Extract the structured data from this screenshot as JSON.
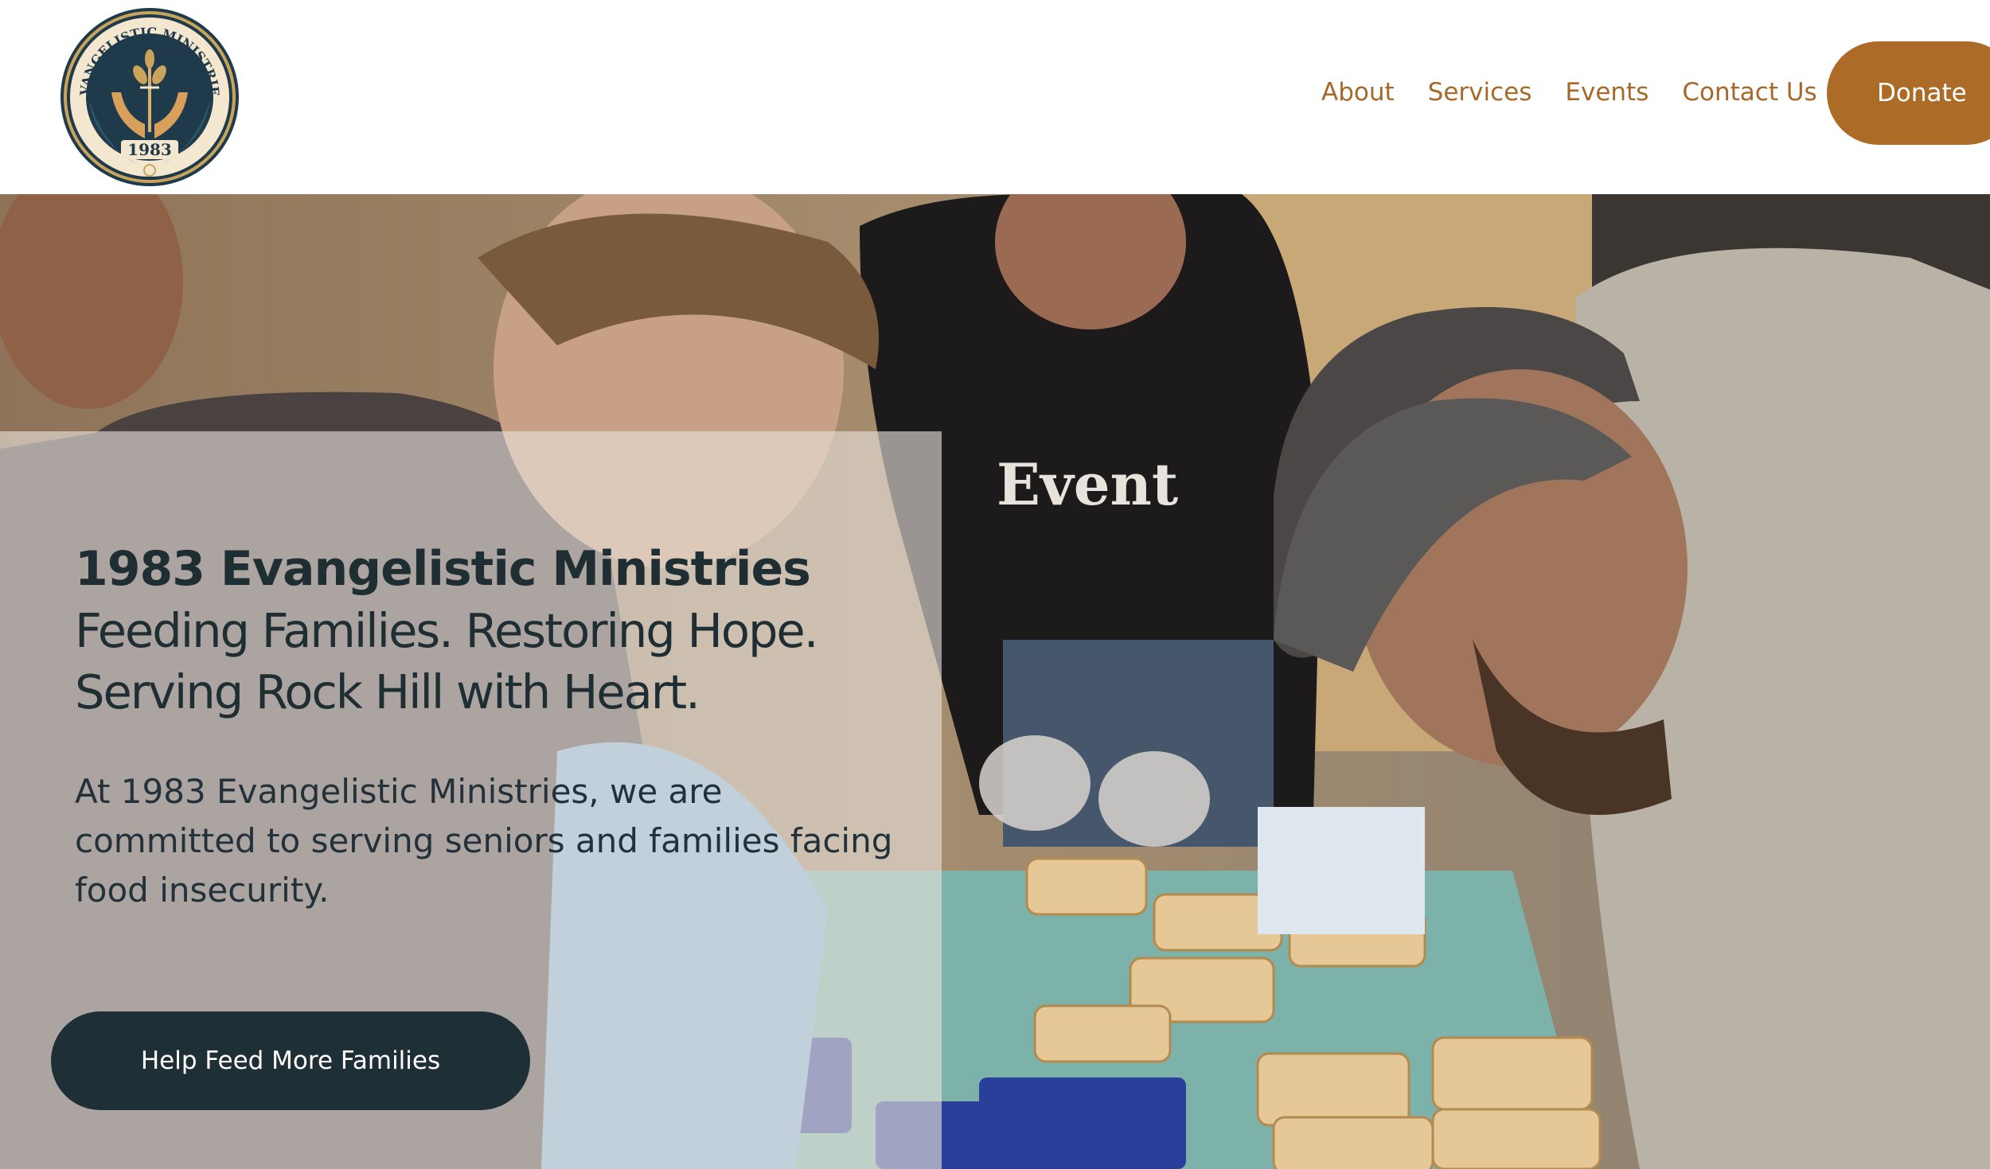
{
  "header": {
    "logo": {
      "ring_text": "EVANGELISTIC MINISTRIES",
      "year": "1983"
    },
    "nav": [
      {
        "label": "About"
      },
      {
        "label": "Services"
      },
      {
        "label": "Events"
      },
      {
        "label": "Contact Us"
      }
    ],
    "donate_label": "Donate"
  },
  "hero": {
    "title": "1983 Evangelistic Ministries",
    "tagline_line1": "Feeding Families. Restoring Hope.",
    "tagline_line2": "Serving Rock Hill with Heart.",
    "intro": "At 1983 Evangelistic Ministries, we are committed to serving seniors and families facing food insecurity.",
    "cta_label": "Help Feed More Families",
    "photo_shirt_text": "Event"
  },
  "colors": {
    "accent": "#ad6b28",
    "nav_text": "#a7692a",
    "dark": "#1f2f36",
    "overlay": "#e8e2dc"
  }
}
